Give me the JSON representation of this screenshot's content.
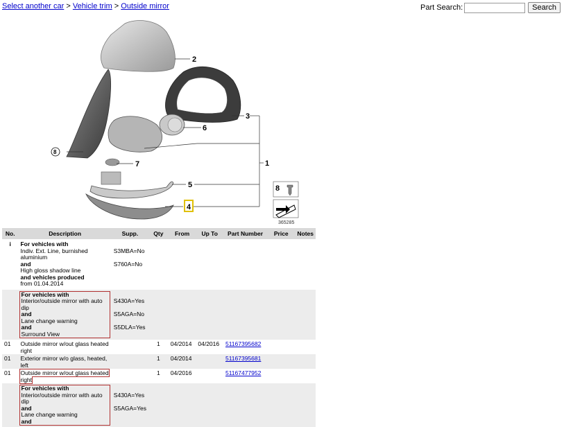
{
  "breadcrumb": [
    "Select another car",
    "Vehicle trim",
    "Outside mirror"
  ],
  "breadcrumb_sep": ">",
  "search": {
    "label": "Part Search:",
    "placeholder": "",
    "button": "Search"
  },
  "diagram": {
    "id": "365285",
    "callouts": [
      "2",
      "3",
      "6",
      "8",
      "7",
      "1",
      "5",
      "4"
    ],
    "legend_number": "8"
  },
  "table": {
    "headers": [
      "No.",
      "Description",
      "Supp.",
      "Qty",
      "From",
      "Up To",
      "Part Number",
      "Price",
      "Notes"
    ],
    "note1": {
      "icon": "i",
      "lines": [
        {
          "text": "For vehicles with",
          "bold": true,
          "supp": ""
        },
        {
          "text": "Indiv. Ext. Line, burnished aluminium",
          "bold": false,
          "supp": "S3MBA=No"
        },
        {
          "text": "and",
          "bold": true,
          "supp": ""
        },
        {
          "text": "High gloss shadow line",
          "bold": false,
          "supp": "S760A=No"
        },
        {
          "text": "and vehicles produced",
          "bold": true,
          "supp": ""
        },
        {
          "text": "from 01.04.2014",
          "bold": false,
          "supp": ""
        }
      ]
    },
    "note2": {
      "lines": [
        {
          "text": "For vehicles with",
          "bold": true,
          "supp": ""
        },
        {
          "text": "Interior/outside mirror with auto dip",
          "bold": false,
          "supp": "S430A=Yes"
        },
        {
          "text": "and",
          "bold": true,
          "supp": ""
        },
        {
          "text": "Lane change warning",
          "bold": false,
          "supp": "S5AGA=No"
        },
        {
          "text": "and",
          "bold": true,
          "supp": ""
        },
        {
          "text": "Surround View",
          "bold": false,
          "supp": "S5DLA=Yes"
        }
      ]
    },
    "rows": [
      {
        "no": "01",
        "desc": "Outside mirror w/out glass heated right",
        "qty": "1",
        "from": "04/2014",
        "upto": "04/2016",
        "part": "51167395682"
      },
      {
        "no": "01",
        "desc": "Exterior mirror w/o glass, heated, left",
        "qty": "1",
        "from": "04/2014",
        "upto": "",
        "part": "51167395681"
      },
      {
        "no": "01",
        "desc": "Outside mirror w/out glass heated right",
        "qty": "1",
        "from": "04/2016",
        "upto": "",
        "part": "51167477952"
      }
    ],
    "note3": {
      "lines": [
        {
          "text": "For vehicles with",
          "bold": true,
          "supp": ""
        },
        {
          "text": "Interior/outside mirror with auto dip",
          "bold": false,
          "supp": "S430A=Yes"
        },
        {
          "text": "and",
          "bold": true,
          "supp": ""
        },
        {
          "text": "Lane change warning",
          "bold": false,
          "supp": "S5AGA=Yes"
        },
        {
          "text": "and",
          "bold": true,
          "supp": ""
        }
      ]
    }
  }
}
